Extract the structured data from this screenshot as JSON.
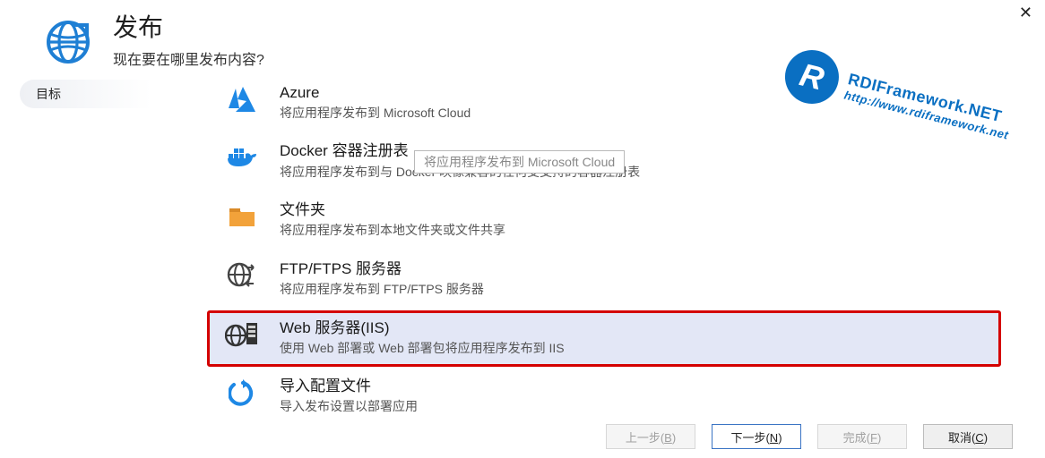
{
  "header": {
    "title": "发布",
    "subtitle": "现在要在哪里发布内容?"
  },
  "sidebar": {
    "items": [
      {
        "label": "目标",
        "selected": true
      }
    ]
  },
  "tooltip_text": "将应用程序发布到 Microsoft Cloud",
  "options": [
    {
      "id": "azure",
      "title": "Azure",
      "desc": "将应用程序发布到 Microsoft Cloud"
    },
    {
      "id": "docker",
      "title": "Docker 容器注册表",
      "desc": "将应用程序发布到与 Docker 映像兼容的任何受支持的容器注册表"
    },
    {
      "id": "folder",
      "title": "文件夹",
      "desc": "将应用程序发布到本地文件夹或文件共享"
    },
    {
      "id": "ftp",
      "title": "FTP/FTPS 服务器",
      "desc": "将应用程序发布到 FTP/FTPS 服务器"
    },
    {
      "id": "iis",
      "title": "Web 服务器(IIS)",
      "desc": "使用 Web 部署或 Web 部署包将应用程序发布到 IIS",
      "selected": true
    },
    {
      "id": "import",
      "title": "导入配置文件",
      "desc": "导入发布设置以部署应用"
    }
  ],
  "buttons": {
    "back": "上一步(B)",
    "next": "下一步(N)",
    "finish": "完成(F)",
    "cancel": "取消(C)"
  },
  "watermark": {
    "line1": "RDIFramework.NET",
    "line2": "http://www.rdiframework.net"
  },
  "colors": {
    "accent": "#1272c2",
    "highlight_outline": "#d40000",
    "selected_bg": "#e3e7f6"
  }
}
